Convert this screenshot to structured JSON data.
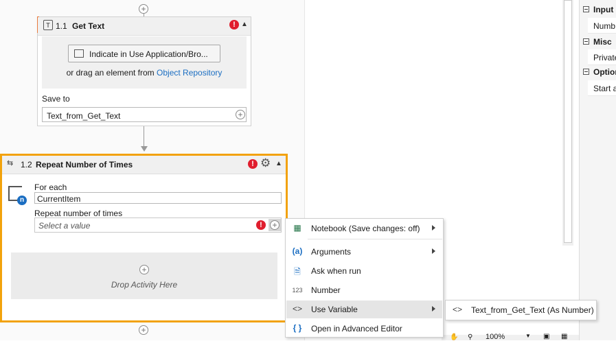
{
  "get_text": {
    "number": "1.1",
    "title": "Get Text",
    "error": "!",
    "indicate_button": "Indicate in Use Application/Bro...",
    "drag_text": "or drag an element from",
    "object_repository_link": "Object Repository",
    "save_to_label": "Save to",
    "save_to_value": "Text_from_Get_Text"
  },
  "repeat": {
    "number": "1.2",
    "title": "Repeat Number of Times",
    "error": "!",
    "for_each_label": "For each",
    "for_each_value": "CurrentItem",
    "repeat_label": "Repeat number of times",
    "repeat_placeholder": "Select a value",
    "drop_text": "Drop Activity Here"
  },
  "properties": {
    "categories": [
      {
        "label": "Input",
        "row": "Numb"
      },
      {
        "label": "Misc",
        "row": "Private"
      },
      {
        "label": "Option",
        "row": "Start a"
      }
    ]
  },
  "context_menu": {
    "items": [
      {
        "icon": "notebook-icon",
        "label": "Notebook (Save changes: off)",
        "submenu": true
      },
      {
        "icon": "arguments-icon",
        "label": "Arguments",
        "submenu": true
      },
      {
        "icon": "ask-when-run-icon",
        "label": "Ask when run",
        "submenu": false
      },
      {
        "icon": "number-icon",
        "label": "Number",
        "submenu": false
      },
      {
        "icon": "use-variable-icon",
        "label": "Use Variable",
        "submenu": true
      },
      {
        "icon": "advanced-editor-icon",
        "label": "Open in Advanced Editor",
        "submenu": false
      }
    ]
  },
  "submenu": {
    "item": "Text_from_Get_Text (As Number)"
  },
  "status_bar": {
    "zoom": "100%"
  },
  "colors": {
    "selected_border": "#f2a20c",
    "error_red": "#e01e2e",
    "link_blue": "#1b6ec2",
    "left_accent": "#e87a3c"
  }
}
